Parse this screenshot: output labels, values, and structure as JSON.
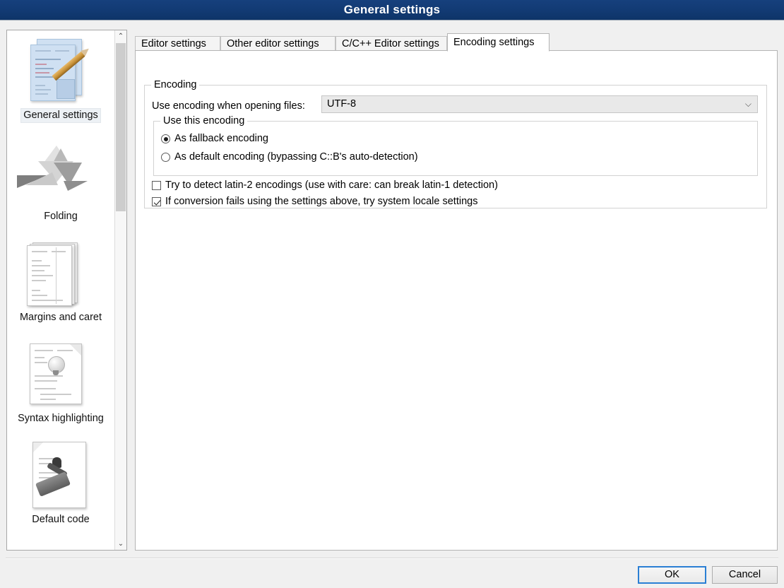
{
  "window": {
    "title": "General settings",
    "titlebar_color": "#123a73"
  },
  "sidebar": {
    "items": [
      {
        "label": "General settings",
        "icon": "documents-pencil-icon",
        "selected": true
      },
      {
        "label": "Folding",
        "icon": "origami-bird-icon",
        "selected": false
      },
      {
        "label": "Margins and caret",
        "icon": "stacked-pages-icon",
        "selected": false
      },
      {
        "label": "Syntax highlighting",
        "icon": "document-bulb-icon",
        "selected": false
      },
      {
        "label": "Default code",
        "icon": "document-stamp-icon",
        "selected": false
      }
    ],
    "scrollbar": {
      "up_glyph": "⌃",
      "down_glyph": "⌄"
    }
  },
  "main": {
    "tabs": [
      {
        "label": "Editor settings",
        "active": false
      },
      {
        "label": "Other editor settings",
        "active": false
      },
      {
        "label": "C/C++ Editor settings",
        "active": false
      },
      {
        "label": "Encoding settings",
        "active": true
      }
    ],
    "encoding_group": {
      "title": "Encoding",
      "encoding_label": "Use encoding when opening files:",
      "encoding_value": "UTF-8",
      "encoding_dropdown_glyph": "⌵",
      "use_this_encoding_group": {
        "title": "Use this encoding",
        "options": [
          {
            "label": "As fallback encoding",
            "checked": true
          },
          {
            "label": "As default encoding (bypassing C::B's auto-detection)",
            "checked": false
          }
        ]
      },
      "checkboxes": [
        {
          "label": "Try to detect latin-2 encodings (use with care: can break latin-1 detection)",
          "checked": false
        },
        {
          "label": "If conversion fails using the settings above, try system locale settings",
          "checked": true
        }
      ]
    }
  },
  "footer": {
    "ok_label": "OK",
    "cancel_label": "Cancel"
  }
}
